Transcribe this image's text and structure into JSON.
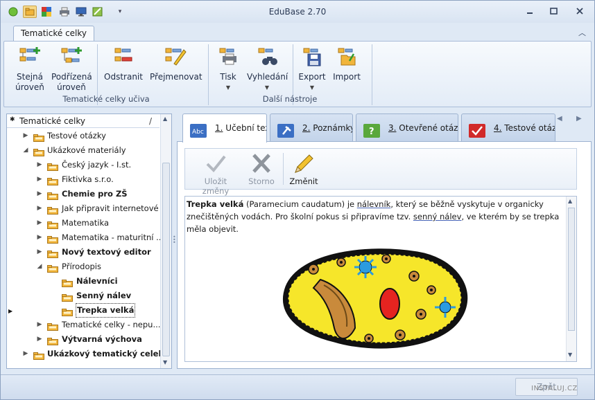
{
  "window": {
    "title": "EduBase 2.70"
  },
  "ribbon": {
    "tab": "Tematické celky",
    "groups": [
      {
        "label": "Tematické celky učiva"
      },
      {
        "label": "Další nástroje"
      }
    ],
    "buttons": {
      "same_level": [
        "Stejná",
        "úroveň"
      ],
      "sub_level": [
        "Podřízená",
        "úroveň"
      ],
      "remove": "Odstranit",
      "rename": "Přejmenovat",
      "print": "Tisk",
      "search": "Vyhledání",
      "export": "Export",
      "import": "Import"
    }
  },
  "tree": {
    "header": "Tematické celky",
    "header_mark": "/",
    "items": [
      {
        "label": "Testové otázky",
        "bold": false
      },
      {
        "label": "Ukázkové materiály",
        "bold": false
      },
      {
        "label": "Český jazyk - I.st.",
        "bold": false
      },
      {
        "label": "Fiktivka s.r.o.",
        "bold": false
      },
      {
        "label": "Chemie pro ZŠ",
        "bold": true
      },
      {
        "label": "Jak připravit internetové ...",
        "bold": false
      },
      {
        "label": "Matematika",
        "bold": false
      },
      {
        "label": "Matematika - maturitní ...",
        "bold": false
      },
      {
        "label": "Nový textový editor",
        "bold": true
      },
      {
        "label": "Přírodopis",
        "bold": false
      },
      {
        "label": "Nálevníci",
        "bold": true
      },
      {
        "label": "Senný nálev",
        "bold": true
      },
      {
        "label": "Trepka velká",
        "bold": true
      },
      {
        "label": "Tematické celky - nepu...",
        "bold": false
      },
      {
        "label": "Výtvarná výchova",
        "bold": true
      },
      {
        "label": "Ukázkový tematický celek",
        "bold": true
      }
    ]
  },
  "tabs": [
    {
      "num": "1.",
      "label": "Učební text",
      "icon": "abc-text-icon"
    },
    {
      "num": "2.",
      "label": "Poznámky",
      "icon": "pin-note-icon"
    },
    {
      "num": "3.",
      "label": "Otevřené otázky",
      "icon": "question-icon"
    },
    {
      "num": "4.",
      "label": "Testové otázky",
      "icon": "checkmark-icon"
    }
  ],
  "toolbar": {
    "save": "Uložit změny",
    "cancel": "Storno",
    "edit": "Změnit"
  },
  "document": {
    "bold_title": "Trepka velká",
    "t1": " (Paramecium caudatum) je ",
    "link1": "nálevník",
    "t2": ", který se běžně vyskytuje v organicky znečištěných vodách. Pro školní  pokus si připravíme tzv. ",
    "link2": "senný nálev",
    "t3": ", ve kterém by se trepka měla objevit."
  },
  "status": {
    "back": "Zpět"
  },
  "watermark": "INSTALUJ.CZ",
  "colors": {
    "accent": "#3b6fc4",
    "folder": "#f1b53b",
    "ribbon_bg": "#e3ecf7"
  }
}
